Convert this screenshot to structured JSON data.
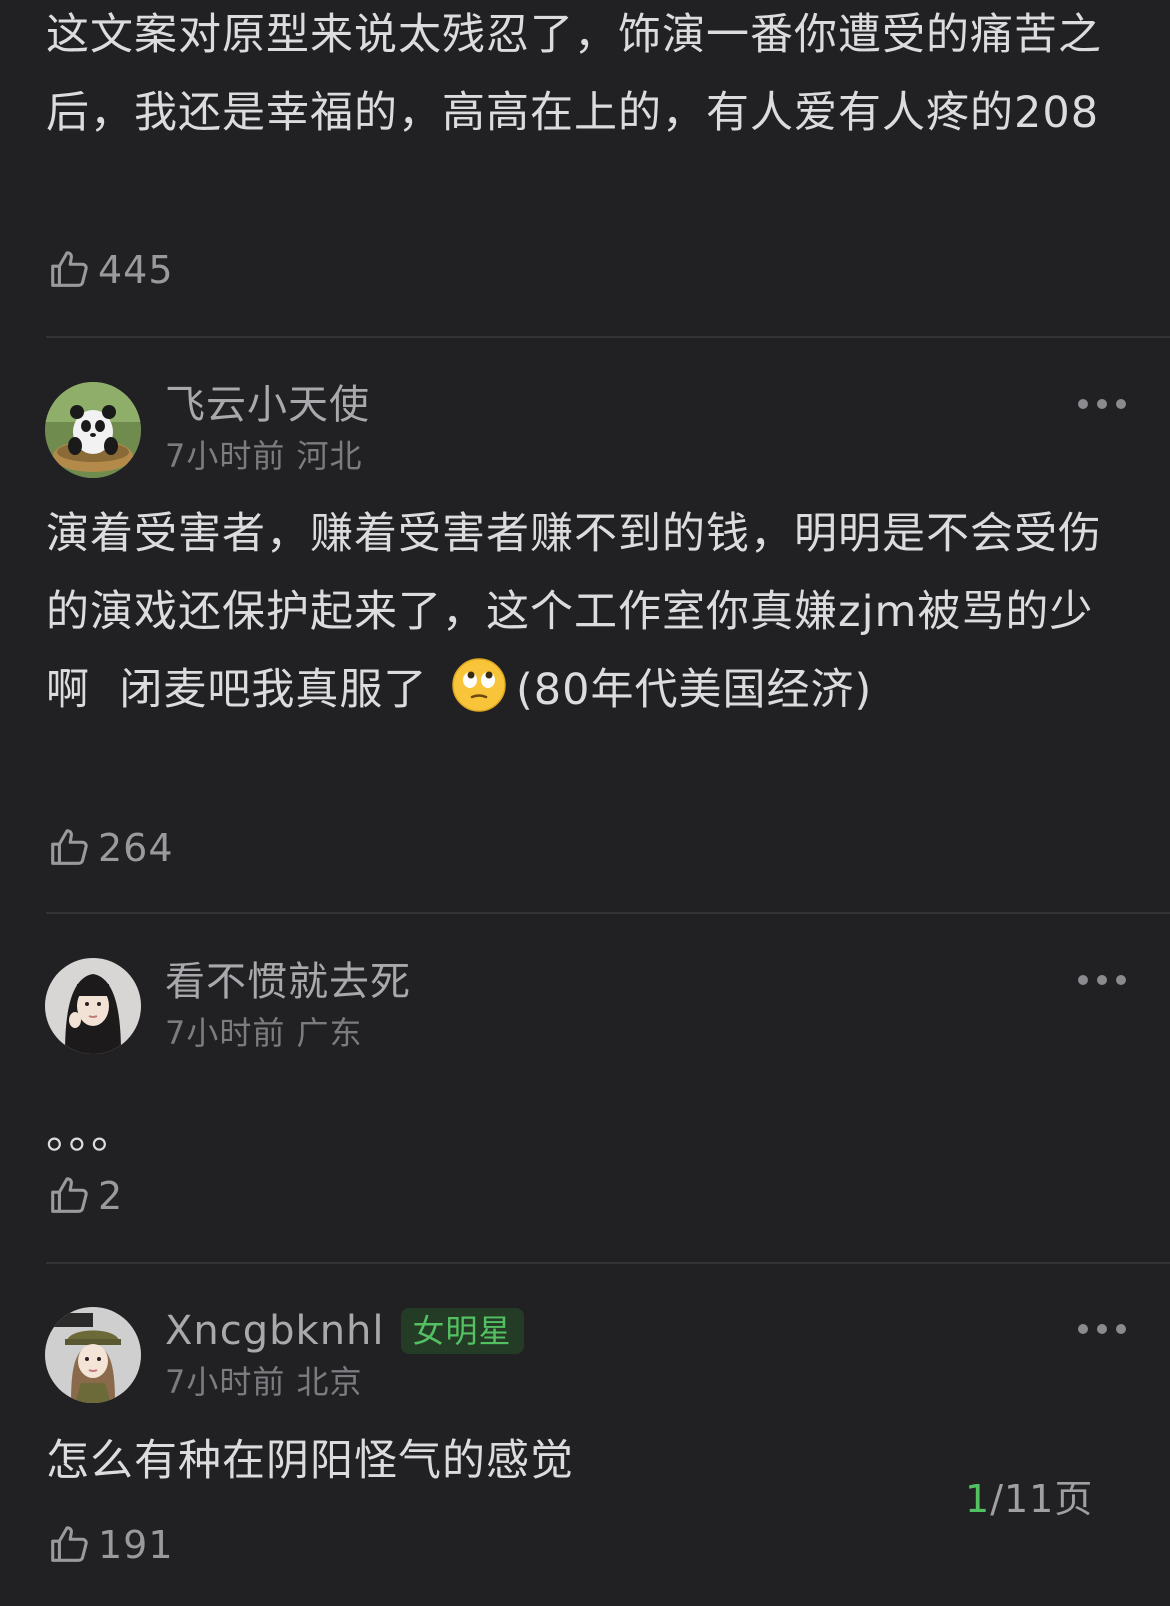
{
  "comments": [
    {
      "text": "这文案对原型来说太残忍了，饰演一番你遭受的痛苦之后，我还是幸福的，高高在上的，有人爱有人疼的208",
      "likes": "445"
    },
    {
      "username": "飞云小天使",
      "meta": "7小时前 河北",
      "text_before_emoji": "演着受害者，赚着受害者赚不到的钱，明明是不会受伤的演戏还保护起来了，这个工作室你真嫌zjm被骂的少啊  闭麦吧我真服了 ",
      "emoji": "eye-roll-emoji",
      "text_after_emoji": "(80年代美国经济)",
      "likes": "264"
    },
    {
      "username": "看不惯就去死",
      "meta": "7小时前 广东",
      "text": "。。。",
      "likes": "2"
    },
    {
      "username": "Xncgbknhl",
      "badge": "女明星",
      "meta": "7小时前 北京",
      "text": "怎么有种在阴阳怪气的感觉",
      "likes": "191"
    }
  ],
  "pager": {
    "current": "1",
    "total": "/11页"
  },
  "colors": {
    "background": "#212123",
    "accent_green": "#53c062"
  }
}
